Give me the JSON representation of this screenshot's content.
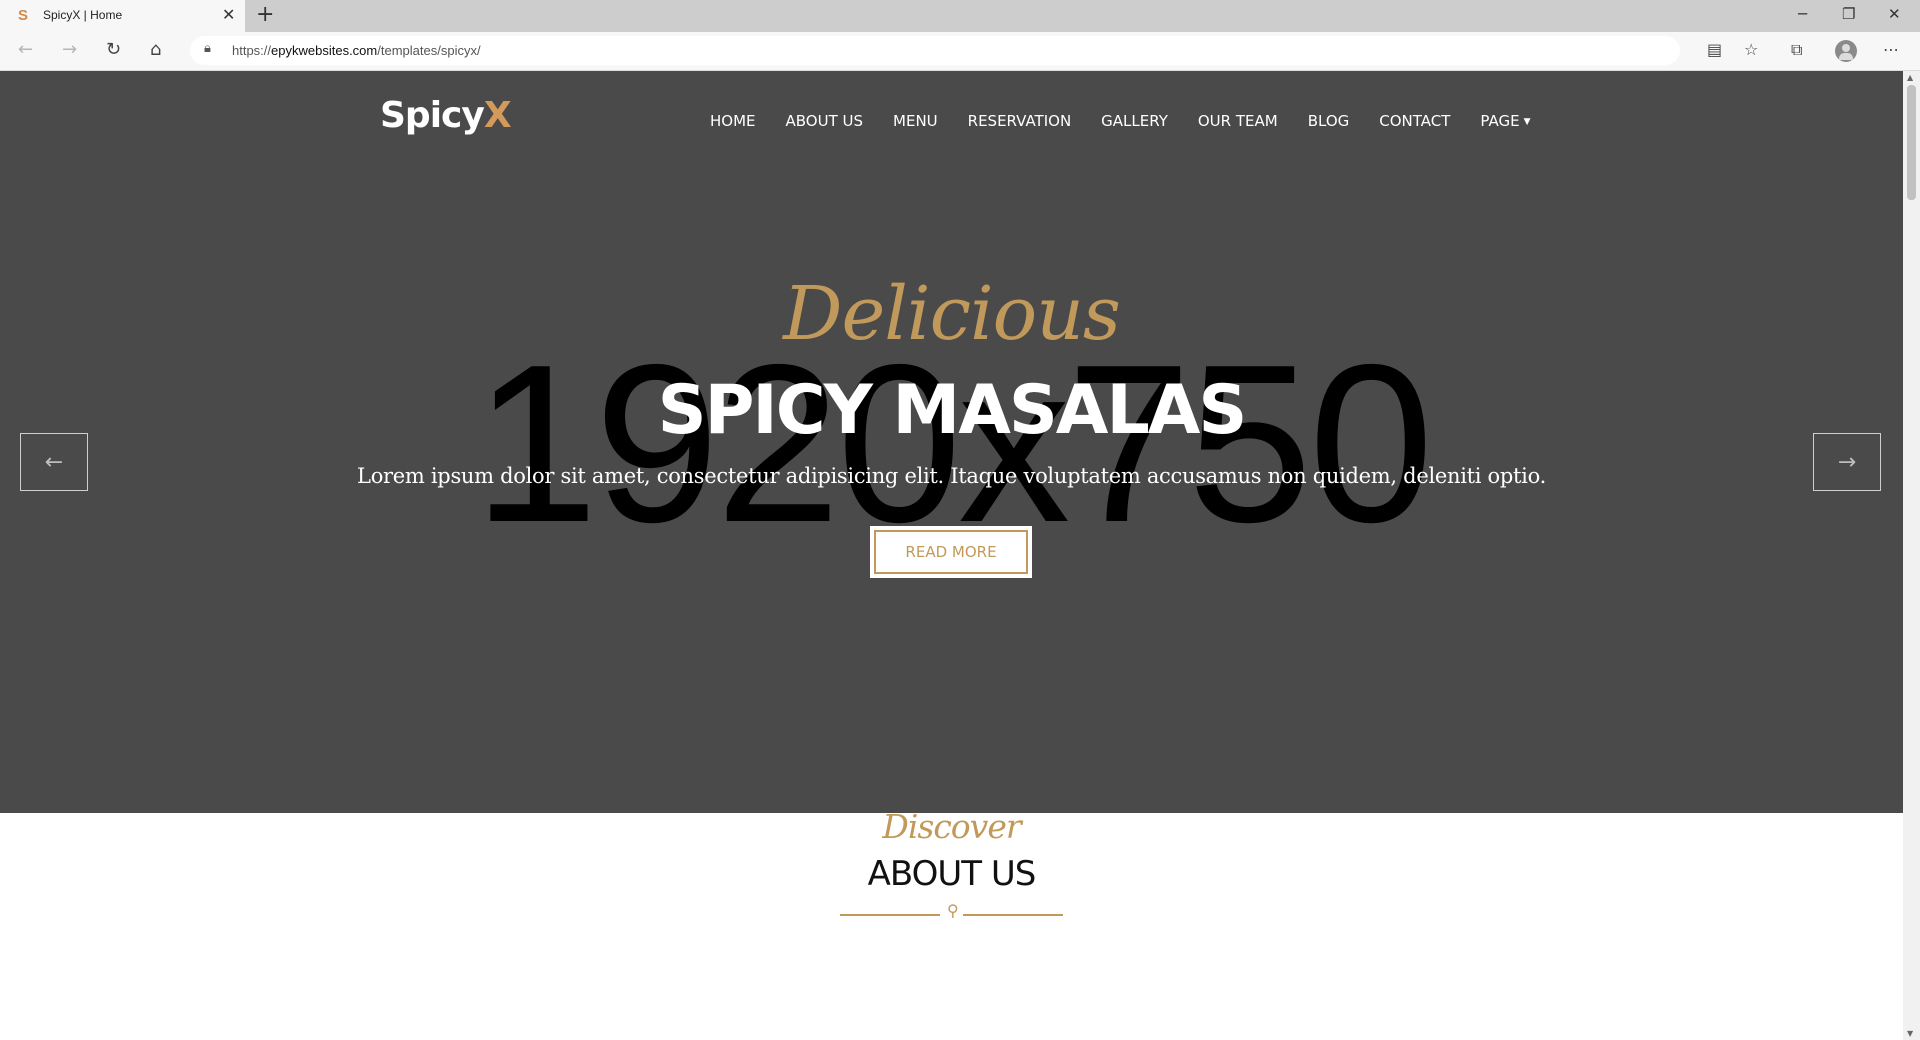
{
  "browser": {
    "tab": {
      "favicon_letter": "S",
      "title": "SpicyX | Home"
    },
    "new_tab_icon": "plus-icon",
    "url_prefix": "https://",
    "url_domain": "epykwebsites.com",
    "url_path": "/templates/spicyx/"
  },
  "site": {
    "logo_main": "Spicy",
    "logo_accent": "X",
    "accent_color": "#d49a5c",
    "gold_color": "#c19a5b",
    "nav": {
      "home": "HOME",
      "about": "ABOUT US",
      "menu": "MENU",
      "reservation": "RESERVATION",
      "gallery": "GALLERY",
      "team": "OUR TEAM",
      "blog": "BLOG",
      "contact": "CONTACT",
      "page": "PAGE"
    }
  },
  "hero": {
    "placeholder_text": "1920x750",
    "script_title": "Delicious",
    "title": "SPICY MASALAS",
    "lead": "Lorem ipsum dolor sit amet, consectetur adipisicing elit. Itaque voluptatem accusamus non quidem, deleniti optio.",
    "button": "READ MORE",
    "prev_icon": "arrow-left-icon",
    "next_icon": "arrow-right-icon"
  },
  "about": {
    "script_title": "Discover",
    "title": "ABOUT US"
  }
}
